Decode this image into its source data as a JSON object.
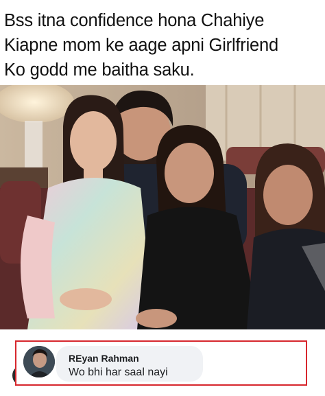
{
  "caption": {
    "line1": "Bss itna confidence hona Chahiye",
    "line2": "Kiapne mom ke aage apni Girlfriend",
    "line3": "Ko godd me baitha saku."
  },
  "photo": {
    "icon": "group-photo-image"
  },
  "comment": {
    "author": "REyan Rahman",
    "text": "Wo bhi har saal nayi",
    "avatar_icon": "commenter-avatar-icon",
    "highlight_color": "#d7272d"
  },
  "user_icon": "user-profile-icon"
}
